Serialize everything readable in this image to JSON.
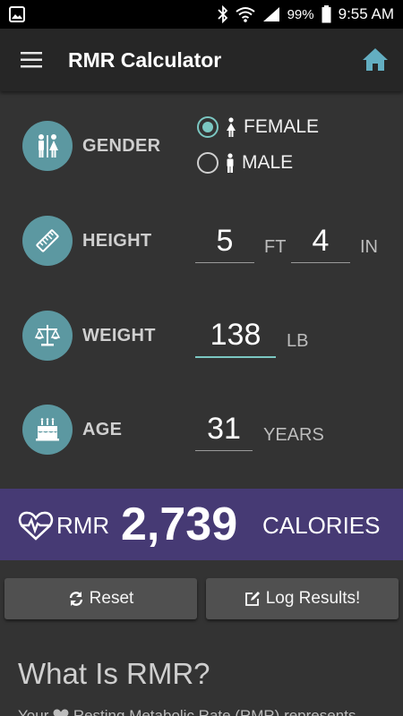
{
  "status_bar": {
    "battery_percent": "99%",
    "time": "9:55 AM"
  },
  "app_bar": {
    "title": "RMR Calculator"
  },
  "form": {
    "gender": {
      "label": "GENDER",
      "options": [
        {
          "label": "FEMALE",
          "selected": true
        },
        {
          "label": "MALE",
          "selected": false
        }
      ]
    },
    "height": {
      "label": "HEIGHT",
      "feet": "5",
      "feet_unit": "FT",
      "inches": "4",
      "inches_unit": "IN"
    },
    "weight": {
      "label": "WEIGHT",
      "value": "138",
      "unit": "LB"
    },
    "age": {
      "label": "AGE",
      "value": "31",
      "unit": "YEARS"
    }
  },
  "result": {
    "label": "RMR",
    "value": "2,739",
    "unit": "CALORIES"
  },
  "buttons": {
    "reset": "Reset",
    "log": "Log Results!"
  },
  "info": {
    "heading": "What Is RMR?",
    "text_prefix": "Your",
    "text_rest": "Resting Metabolic Rate (RMR) represents"
  },
  "colors": {
    "accent": "#7bc7c2",
    "icon_circle": "#5c98a1",
    "result_bar": "#463a74",
    "background": "#333333"
  }
}
